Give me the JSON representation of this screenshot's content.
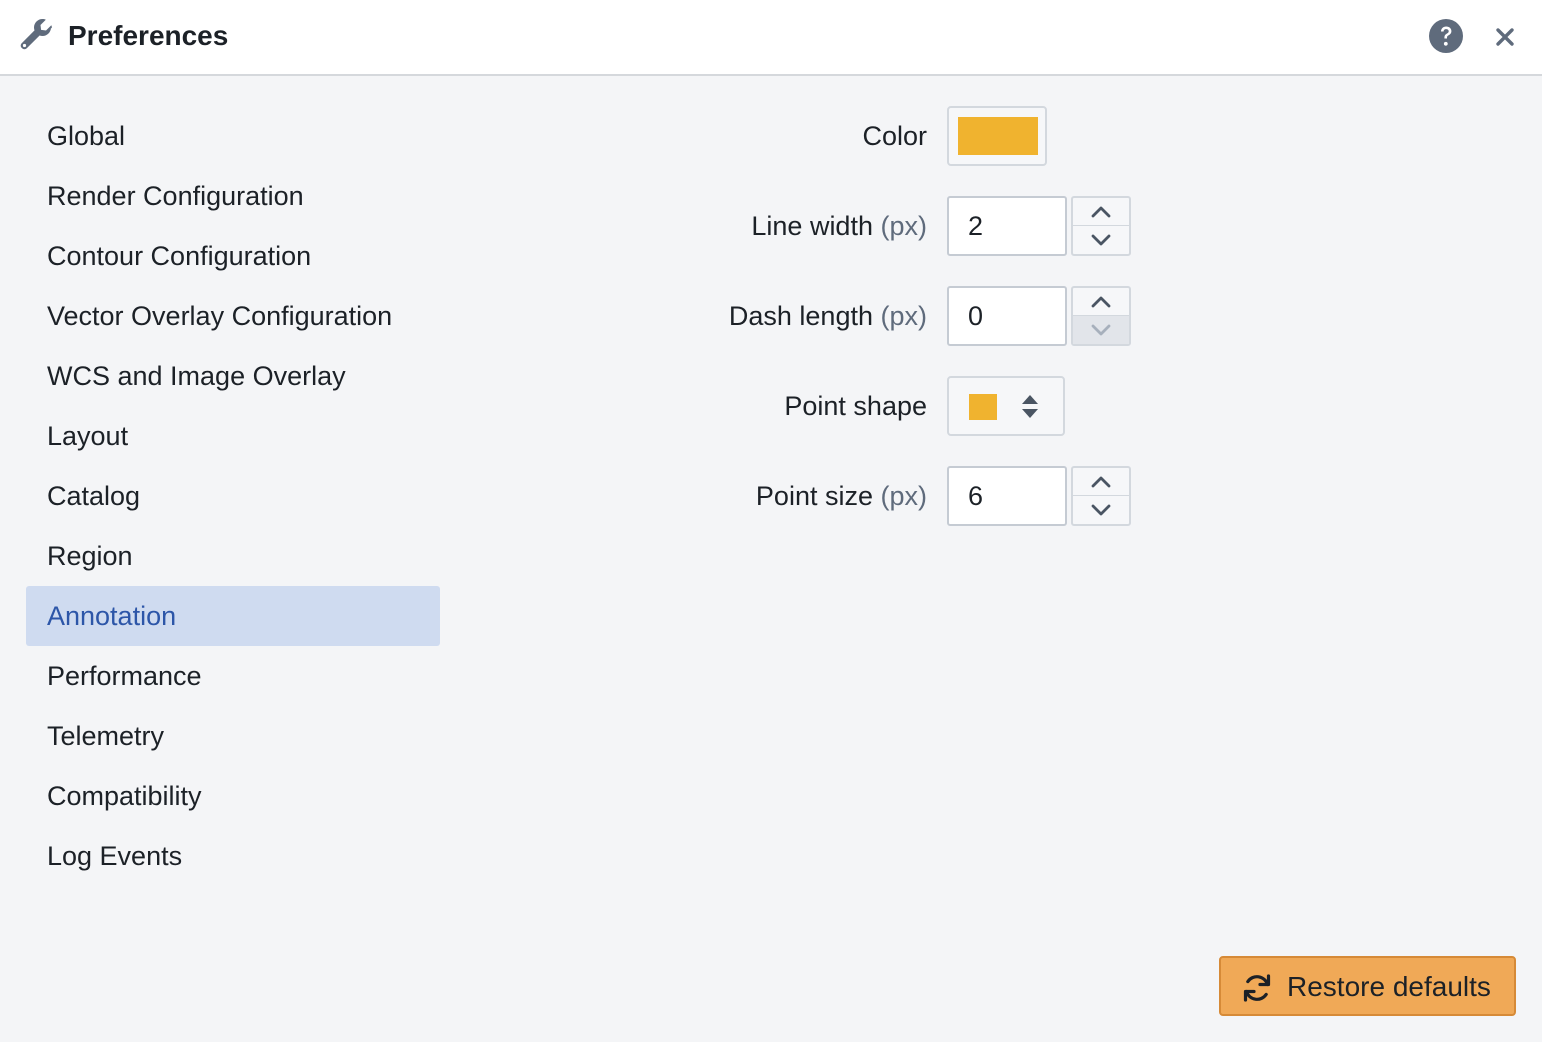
{
  "header": {
    "title": "Preferences",
    "icons": [
      "wrench-icon",
      "help-icon",
      "close-icon"
    ]
  },
  "nav": {
    "items": [
      {
        "label": "Global"
      },
      {
        "label": "Render Configuration"
      },
      {
        "label": "Contour Configuration"
      },
      {
        "label": "Vector Overlay Configuration"
      },
      {
        "label": "WCS and Image Overlay"
      },
      {
        "label": "Layout"
      },
      {
        "label": "Catalog"
      },
      {
        "label": "Region"
      },
      {
        "label": "Annotation"
      },
      {
        "label": "Performance"
      },
      {
        "label": "Telemetry"
      },
      {
        "label": "Compatibility"
      },
      {
        "label": "Log Events"
      }
    ],
    "selected": "Annotation"
  },
  "form": {
    "color": {
      "label": "Color",
      "value": "#f0b32f"
    },
    "line_width": {
      "label": "Line width",
      "unit": "(px)",
      "value": "2"
    },
    "dash_length": {
      "label": "Dash length",
      "unit": "(px)",
      "value": "0"
    },
    "point_shape": {
      "label": "Point shape",
      "value": "square",
      "color": "#f0b32f"
    },
    "point_size": {
      "label": "Point size",
      "unit": "(px)",
      "value": "6"
    }
  },
  "footer": {
    "restore_label": "Restore defaults",
    "restore_color": "#f0a957"
  },
  "colors": {
    "selected_nav_bg": "#cfdbf0",
    "selected_nav_text": "#2d56a8",
    "background": "#f4f5f7"
  }
}
